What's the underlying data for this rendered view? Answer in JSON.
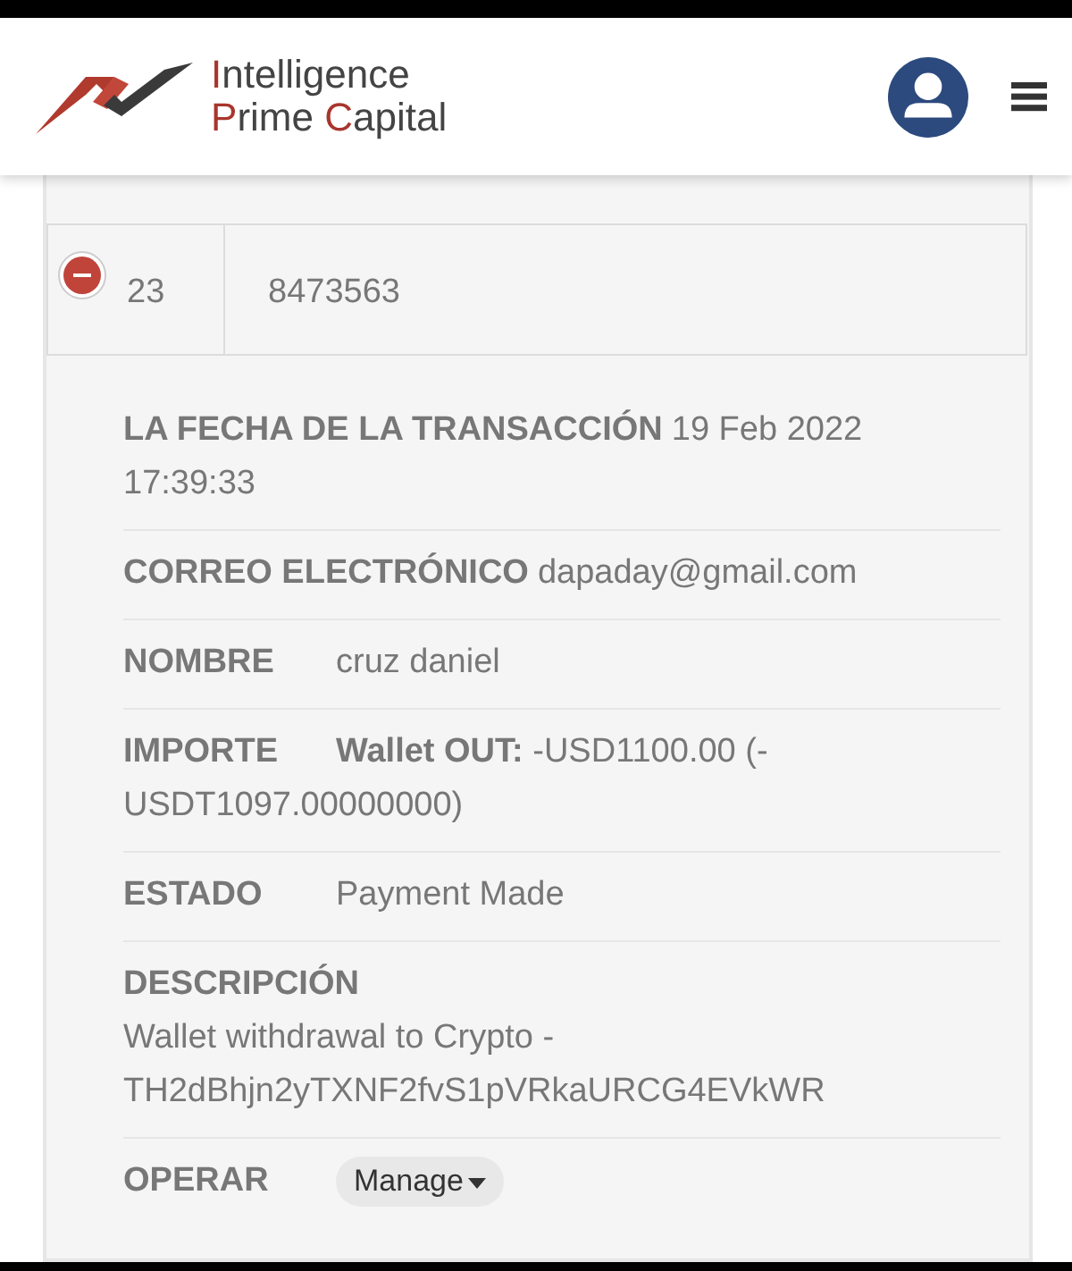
{
  "header": {
    "logo_lines": [
      "Intelligence",
      "Prime Capital"
    ]
  },
  "row": {
    "expanded": true,
    "number": "23",
    "reference": "8473563"
  },
  "details": [
    {
      "label": "LA FECHA DE LA TRANSACCIÓN",
      "value": "19 Feb 2022 17:39:33",
      "kind": "inline"
    },
    {
      "label": "CORREO ELECTRÓNICO",
      "value": "dapaday@gmail.com",
      "kind": "inline"
    },
    {
      "label": "NOMBRE",
      "value": "cruz daniel",
      "kind": "inline"
    },
    {
      "label": "IMPORTE",
      "value": "**Wallet OUT:** -USD1100.00 (-USDT1097.00000000)",
      "kind": "inline"
    },
    {
      "label": "ESTADO",
      "value": "Payment Made",
      "kind": "inline"
    },
    {
      "label": "DESCRIPCIÓN",
      "value": "Wallet withdrawal to Crypto - TH2dBhjn2yTXNF2fvS1pVRkaURCG4EVkWR",
      "kind": "block"
    },
    {
      "label": "OPERAR",
      "button": "Manage",
      "kind": "button"
    }
  ]
}
